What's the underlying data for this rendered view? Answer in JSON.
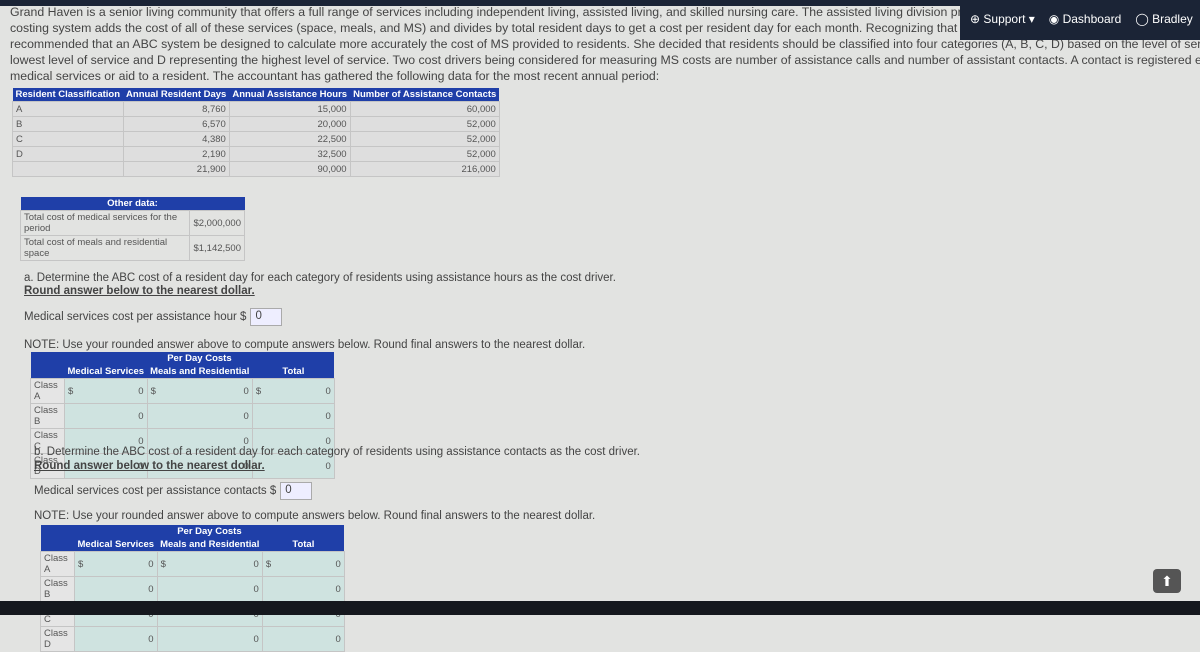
{
  "nav": {
    "support": "Support",
    "dashboard": "Dashboard",
    "user": "Bradley"
  },
  "problem": {
    "lines": [
      "Grand Haven is a senior living community that offers a full range of services including independent living, assisted living, and skilled nursing care. The assisted living division provides residential space, meals, and medical services (MS) to its residents. The curre",
      "costing system adds the cost of all of these services (space, meals, and MS) and divides by total resident days to get a cost per resident day for each month. Recognizing that MS tends to vary significantly among the residents, Grand Haven's accountant",
      "recommended that an ABC system be designed to calculate more accurately the cost of MS provided to residents. She decided that residents should be classified into four categories (A, B, C, D) based on the level of services received, with group A representing",
      "lowest level of service and D representing the highest level of service. Two cost drivers being considered for measuring MS costs are number of assistance calls and number of assistant contacts. A contact is registered each time an assistance professional prov",
      "medical services or aid to a resident. The accountant has gathered the following data for the most recent annual period:"
    ]
  },
  "data_table": {
    "headers": [
      "Resident Classification",
      "Annual Resident Days",
      "Annual Assistance Hours",
      "Number of Assistance Contacts"
    ],
    "rows": [
      [
        "A",
        "8,760",
        "15,000",
        "60,000"
      ],
      [
        "B",
        "6,570",
        "20,000",
        "52,000"
      ],
      [
        "C",
        "4,380",
        "22,500",
        "52,000"
      ],
      [
        "D",
        "2,190",
        "32,500",
        "52,000"
      ],
      [
        "",
        "21,900",
        "90,000",
        "216,000"
      ]
    ]
  },
  "other": {
    "title": "Other data:",
    "rows": [
      [
        "Total cost of medical services for the period",
        "$2,000,000"
      ],
      [
        "Total cost of meals and residential space",
        "$1,142,500"
      ]
    ]
  },
  "part_a": {
    "question": "a. Determine the ABC cost of a resident day for each category of residents using assistance hours as the cost driver.",
    "round": "Round answer below to the nearest dollar.",
    "label": "Medical services cost per assistance hour $",
    "value": "0",
    "note": "NOTE: Use your rounded answer above to compute answers below. Round final answers to the nearest dollar."
  },
  "part_b": {
    "question": "b. Determine the ABC cost of a resident day for each category of residents using assistance contacts as the cost driver.",
    "round": "Round answer below to the nearest dollar.",
    "label": "Medical services cost per assistance contacts $",
    "value": "0",
    "note": "NOTE: Use your rounded answer above to compute answers below. Round final answers to the nearest dollar."
  },
  "per_day": {
    "title": "Per Day Costs",
    "headers": [
      "Medical Services",
      "Meals and Residential",
      "Total"
    ],
    "classes": [
      "Class A",
      "Class B",
      "Class C",
      "Class D"
    ],
    "currency": "$",
    "values": [
      "0",
      "0",
      "0"
    ]
  }
}
